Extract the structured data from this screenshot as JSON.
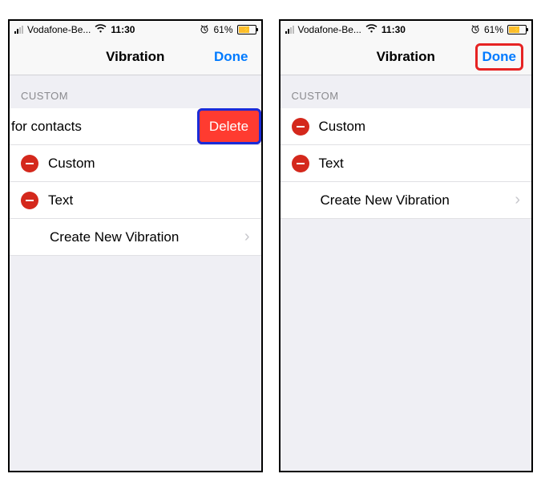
{
  "status": {
    "carrier": "Vodafone-Be...",
    "time": "11:30",
    "battery_pct": "61%"
  },
  "nav": {
    "title": "Vibration",
    "done": "Done"
  },
  "section_header": "CUSTOM",
  "left": {
    "swiped_label": "for contacts",
    "delete": "Delete",
    "items": [
      "Custom",
      "Text"
    ],
    "create": "Create New Vibration"
  },
  "right": {
    "items": [
      "Custom",
      "Text"
    ],
    "create": "Create New Vibration"
  }
}
